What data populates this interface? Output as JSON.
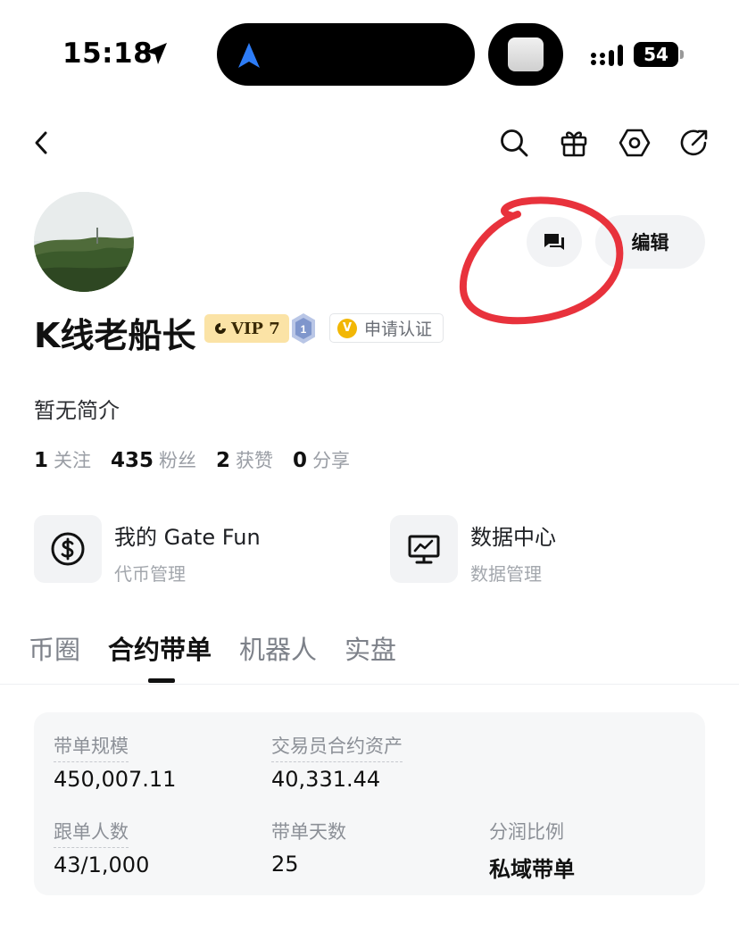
{
  "status_bar": {
    "time": "15:18",
    "battery": "54"
  },
  "profile": {
    "name": "K线老船长",
    "vip": "VIP 7",
    "level": "1",
    "verify_label": "申请认证",
    "bio": "暂无简介",
    "edit_label": "编辑"
  },
  "stats": [
    {
      "num": "1",
      "label": "关注"
    },
    {
      "num": "435",
      "label": "粉丝"
    },
    {
      "num": "2",
      "label": "获赞"
    },
    {
      "num": "0",
      "label": "分享"
    }
  ],
  "tools": [
    {
      "title": "我的 Gate Fun",
      "subtitle": "代币管理"
    },
    {
      "title": "数据中心",
      "subtitle": "数据管理"
    }
  ],
  "tabs": [
    {
      "label": "币圈"
    },
    {
      "label": "合约带单"
    },
    {
      "label": "机器人"
    },
    {
      "label": "实盘"
    }
  ],
  "stats_card": {
    "scale_label": "带单规模",
    "scale_value": "450,007.11",
    "assets_label": "交易员合约资产",
    "assets_value": "40,331.44",
    "followers_label": "跟单人数",
    "followers_value": "43/1,000",
    "days_label": "带单天数",
    "days_value": "25",
    "share_label": "分润比例",
    "share_value": "私域带单"
  },
  "colors": {
    "accent_annotation": "#e8323c",
    "vip_bg": "#fbe3a6",
    "verify_badge": "#f2b705"
  }
}
